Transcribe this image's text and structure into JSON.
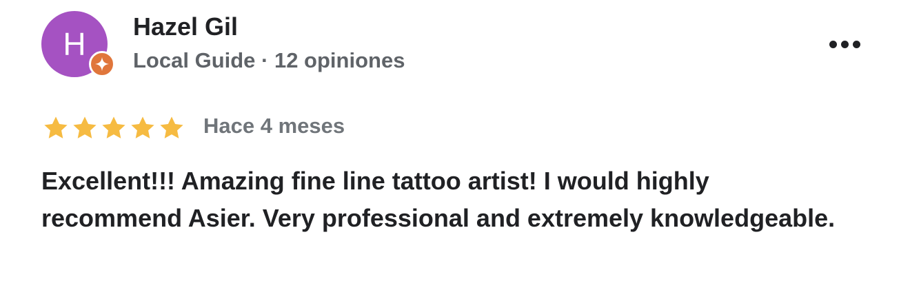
{
  "reviewer": {
    "initial": "H",
    "name": "Hazel Gil",
    "meta": "Local Guide · 12 opiniones",
    "avatar_color": "#a552c2",
    "badge_color": "#e0763b",
    "badge_icon": "local-guide-star-icon"
  },
  "review": {
    "rating": 5,
    "rating_max": 5,
    "star_color": "#f6bb42",
    "date": "Hace 4 meses",
    "text": "Excellent!!! Amazing fine line tattoo artist! I would highly recommend Asier. Very professional and extremely knowledgeable."
  },
  "menu": {
    "icon": "more-horizontal-icon"
  }
}
